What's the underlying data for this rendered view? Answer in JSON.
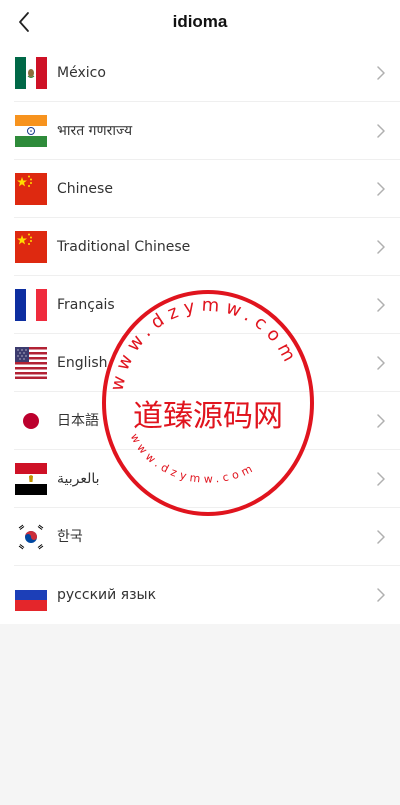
{
  "header": {
    "title": "idioma",
    "back_icon": "chevron-left-icon"
  },
  "languages": [
    {
      "label": "México",
      "flag": "mexico-flag-icon"
    },
    {
      "label": "भारत गणराज्य",
      "flag": "india-flag-icon"
    },
    {
      "label": "Chinese",
      "flag": "china-flag-icon"
    },
    {
      "label": "Traditional Chinese",
      "flag": "china-flag-icon"
    },
    {
      "label": "Français",
      "flag": "france-flag-icon"
    },
    {
      "label": "English",
      "flag": "usa-flag-icon"
    },
    {
      "label": "日本語",
      "flag": "japan-flag-icon"
    },
    {
      "label": "بالعربية",
      "flag": "egypt-flag-icon"
    },
    {
      "label": "한국",
      "flag": "korea-flag-icon"
    },
    {
      "label": "русский язык",
      "flag": "russia-flag-icon"
    }
  ],
  "watermark": {
    "center_text": "道臻源码网",
    "ring_top": "www.dzymw.com",
    "ring_bottom": "www.dzymw.com",
    "color": "#e0141e"
  },
  "colors": {
    "background": "#f5f5f5",
    "row_bg": "#ffffff",
    "divider": "#efefef",
    "chevron": "#b0b0b0"
  }
}
